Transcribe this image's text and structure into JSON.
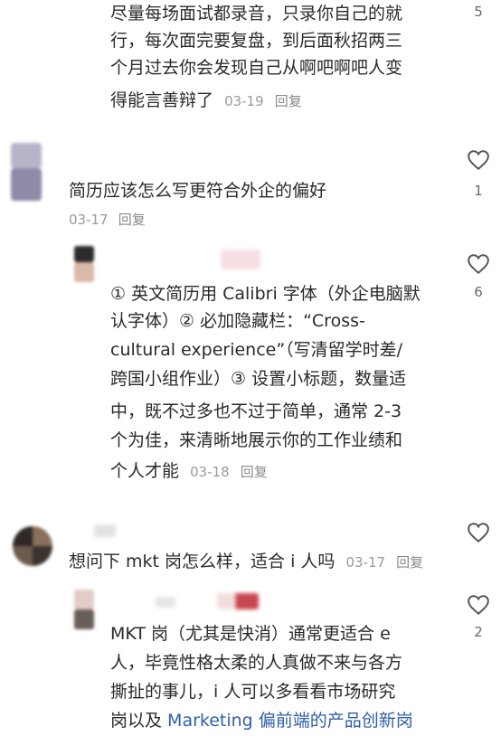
{
  "comments": [
    {
      "lines": [
        "尽量每场面试都录音，只录你自己的就",
        "行，每次面完要复盘，到后面秋招两三",
        "个月过去你会发现自己从啊吧啊吧人变"
      ],
      "last_line": "得能言善辩了",
      "date": "03-19",
      "reply": "回复",
      "likes": "5"
    },
    {
      "text": "简历应该怎么写更符合外企的偏好",
      "date": "03-17",
      "reply": "回复",
      "likes": "1"
    },
    {
      "lines": [
        "① 英文简历用 Calibri 字体（外企电脑默",
        "认字体）② 必加隐藏栏：“Cross-",
        "cultural experience”（写清留学时差/",
        "跨国小组作业）③ 设置小标题，数量适",
        "中，既不过多也不过于简单，通常 2-3",
        "个为佳，来清晰地展示你的工作业绩和"
      ],
      "last_line": "个人才能",
      "date": "03-18",
      "reply": "回复",
      "likes": "6"
    },
    {
      "text": "想问下 mkt 岗怎么样，适合 i 人吗",
      "date": "03-17",
      "reply": "回复",
      "likes": ""
    },
    {
      "lines": [
        "MKT 岗（尤其是快消）通常更适合 e",
        "人，毕竟性格太柔的人真做不来与各方",
        "撕扯的事儿，i 人可以多看看市场研究"
      ],
      "last_line_prefix": "岗以及 ",
      "last_line_link": "Marketing 偏前端的产品创新岗",
      "likes": "2"
    }
  ],
  "icons": {
    "like": "heart-outline-icon"
  },
  "colors": {
    "text": "#2a2a2a",
    "meta": "#9a9a9a",
    "link": "#2f5fa8"
  }
}
